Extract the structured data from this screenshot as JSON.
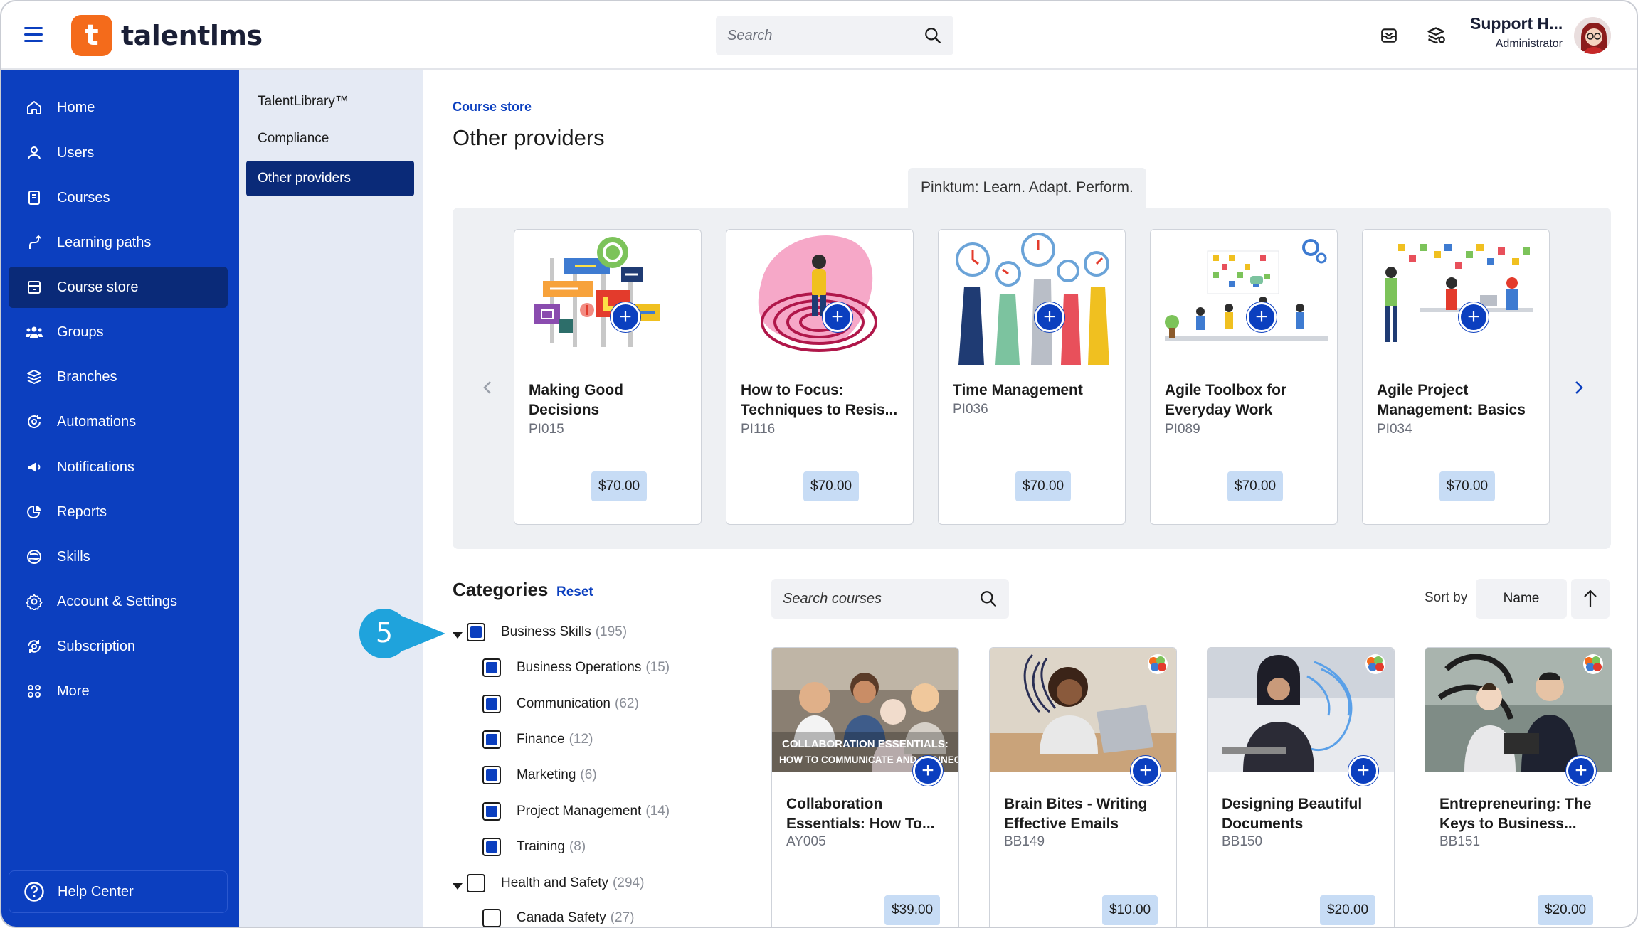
{
  "app": {
    "brand": "talentlms",
    "logo_letter": "t",
    "search_placeholder": "Search",
    "user_name": "Support H...",
    "user_role": "Administrator"
  },
  "sidebar": {
    "items": [
      {
        "label": "Home",
        "icon": "home-icon"
      },
      {
        "label": "Users",
        "icon": "user-icon"
      },
      {
        "label": "Courses",
        "icon": "book-icon"
      },
      {
        "label": "Learning paths",
        "icon": "path-icon"
      },
      {
        "label": "Course store",
        "icon": "store-icon",
        "active": true
      },
      {
        "label": "Groups",
        "icon": "groups-icon"
      },
      {
        "label": "Branches",
        "icon": "layers-icon"
      },
      {
        "label": "Automations",
        "icon": "automation-icon"
      },
      {
        "label": "Notifications",
        "icon": "megaphone-icon"
      },
      {
        "label": "Reports",
        "icon": "pie-chart-icon"
      },
      {
        "label": "Skills",
        "icon": "globe-icon"
      },
      {
        "label": "Account & Settings",
        "icon": "gear-icon"
      },
      {
        "label": "Subscription",
        "icon": "refresh-dollar-icon"
      },
      {
        "label": "More",
        "icon": "grid-icon"
      }
    ],
    "help_label": "Help Center"
  },
  "submenu": {
    "items": [
      {
        "label": "TalentLibrary™"
      },
      {
        "label": "Compliance"
      },
      {
        "label": "Other providers",
        "active": true
      }
    ]
  },
  "main": {
    "breadcrumb": "Course store",
    "title": "Other providers",
    "provider_tab": "Pinktum: Learn. Adapt. Perform.",
    "featured": [
      {
        "title": "Making Good Decisions",
        "code": "PI015",
        "price": "$70.00"
      },
      {
        "title": "How to Focus: Techniques to Resis...",
        "code": "PI116",
        "price": "$70.00"
      },
      {
        "title": "Time Management",
        "code": "PI036",
        "price": "$70.00"
      },
      {
        "title": "Agile Toolbox for Everyday Work",
        "code": "PI089",
        "price": "$70.00"
      },
      {
        "title": "Agile Project Management: Basics",
        "code": "PI034",
        "price": "$70.00"
      }
    ],
    "categories_title": "Categories",
    "reset_label": "Reset",
    "categories": [
      {
        "label": "Business Skills",
        "count": "(195)",
        "checked": true,
        "level": 0,
        "expanded": true
      },
      {
        "label": "Business Operations",
        "count": "(15)",
        "checked": true,
        "level": 1
      },
      {
        "label": "Communication",
        "count": "(62)",
        "checked": true,
        "level": 1
      },
      {
        "label": "Finance",
        "count": "(12)",
        "checked": true,
        "level": 1
      },
      {
        "label": "Marketing",
        "count": "(6)",
        "checked": true,
        "level": 1
      },
      {
        "label": "Project Management",
        "count": "(14)",
        "checked": true,
        "level": 1
      },
      {
        "label": "Training",
        "count": "(8)",
        "checked": true,
        "level": 1
      },
      {
        "label": "Health and Safety",
        "count": "(294)",
        "checked": false,
        "level": 0,
        "expanded": true
      },
      {
        "label": "Canada Safety",
        "count": "(27)",
        "checked": false,
        "level": 1
      }
    ],
    "callout_number": "5",
    "search_courses_placeholder": "Search courses",
    "sort_label": "Sort by",
    "sort_value": "Name",
    "courses": [
      {
        "title": "Collaboration Essentials: How To...",
        "code": "AY005",
        "price": "$39.00",
        "overlay": "COLLABORATION ESSENTIALS:",
        "overlay2": "HOW TO COMMUNICATE AND CONNECT"
      },
      {
        "title": "Brain Bites - Writing Effective Emails",
        "code": "BB149",
        "price": "$10.00"
      },
      {
        "title": "Designing Beautiful Documents",
        "code": "BB150",
        "price": "$20.00"
      },
      {
        "title": "Entrepreneuring: The Keys to Business...",
        "code": "BB151",
        "price": "$20.00"
      }
    ]
  },
  "colors": {
    "brand_blue": "#0c3fbf",
    "active_nav": "#0a2a78",
    "brand_orange": "#f46b1b",
    "price_bg": "#c7dcf5",
    "callout": "#1fa3dc"
  }
}
